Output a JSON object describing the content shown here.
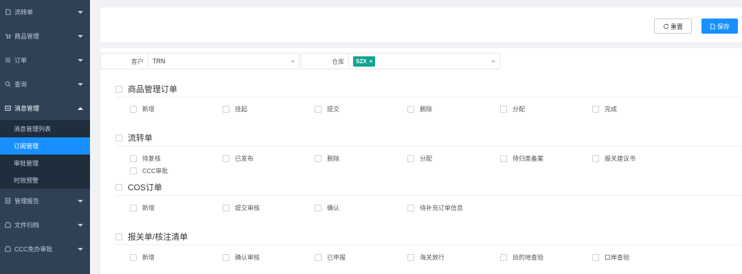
{
  "sidebar": {
    "items": [
      {
        "label": "流转单",
        "icon": "flow-icon"
      },
      {
        "label": "商品管理",
        "icon": "cart-icon"
      },
      {
        "label": "订单",
        "icon": "order-icon"
      },
      {
        "label": "查询",
        "icon": "search-icon"
      },
      {
        "label": "消息管理",
        "icon": "message-icon",
        "open": true,
        "children": [
          {
            "label": "消息管理列表"
          },
          {
            "label": "订阅管理",
            "active": true
          },
          {
            "label": "审批管理"
          },
          {
            "label": "时效预警"
          }
        ]
      },
      {
        "label": "管理报告",
        "icon": "report-icon"
      },
      {
        "label": "文件归档",
        "icon": "archive-icon"
      },
      {
        "label": "CCC免办审批",
        "icon": "approve-icon"
      }
    ]
  },
  "toolbar": {
    "reset_label": "重置",
    "save_label": "保存"
  },
  "filters": {
    "customer_label": "客户",
    "customer_value": "TRN",
    "warehouse_label": "仓库",
    "warehouse_tag": "SZX",
    "tag_close": "×"
  },
  "sections": [
    {
      "title": "商品管理订单",
      "options": [
        "新增",
        "挂起",
        "提交",
        "删除",
        "分配",
        "完成"
      ]
    },
    {
      "title": "流转单",
      "options": [
        "待复核",
        "已发布",
        "删除",
        "分配",
        "待归类备案",
        "报关建议书",
        "CCC审批"
      ]
    },
    {
      "title": "COS订单",
      "options": [
        "新增",
        "提交审核",
        "确认",
        "待补充订单信息"
      ]
    },
    {
      "title": "报关单/核注清单",
      "options": [
        "新增",
        "确认审核",
        "已申报",
        "海关放行",
        "目的地查验",
        "口岸查验"
      ]
    }
  ],
  "colors": {
    "sidebar_bg": "#304156",
    "submenu_bg": "#1f2d3d",
    "accent": "#1890ff",
    "tag": "#13a390"
  }
}
